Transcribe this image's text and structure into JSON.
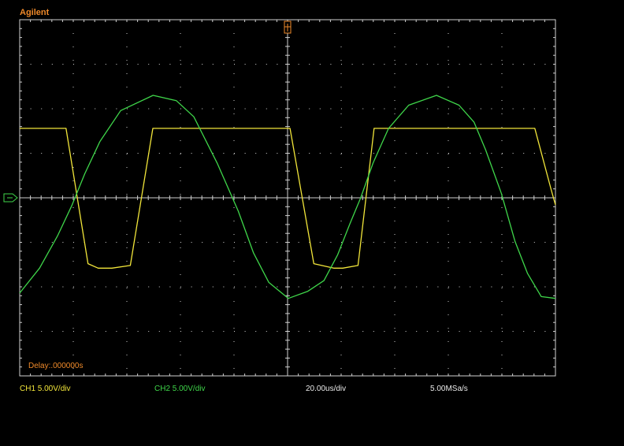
{
  "brand": "Agilent",
  "delay_text": "Delay:.000000s",
  "footer": {
    "ch1": "CH1 5.00V/div",
    "ch2": "CH2 5.00V/div",
    "timebase": "20.00us/div",
    "sample_rate": "5.00MSa/s"
  },
  "colors": {
    "ch1": "#f2e63a",
    "ch2": "#3fd64a",
    "accent": "#f08a2a",
    "grid": "#d0d0d0"
  },
  "chart_data": {
    "type": "line",
    "grid": true,
    "xlim": [
      -100,
      100
    ],
    "ylim": [
      -20,
      20
    ],
    "x_unit": "us",
    "y_unit": "V",
    "x_divisions": 10,
    "y_divisions": 8,
    "series": [
      {
        "name": "CH1",
        "color": "#f2e63a",
        "x": [
          -100,
          -82.7,
          -74.5,
          -70.7,
          -65.6,
          -58.7,
          -50.3,
          0.9,
          9.8,
          17.2,
          20.6,
          26.3,
          32.3,
          40.8,
          92.3,
          98.5,
          100
        ],
        "y": [
          7.8,
          7.8,
          -7.4,
          -7.9,
          -7.9,
          -7.6,
          7.8,
          7.8,
          -7.4,
          -7.9,
          -7.9,
          -7.6,
          7.8,
          7.8,
          7.8,
          0.8,
          -0.8
        ]
      },
      {
        "name": "CH2",
        "color": "#3fd64a",
        "x": [
          -100,
          -92.6,
          -85.9,
          -80.6,
          -75.7,
          -70.1,
          -62.3,
          -50.2,
          -41.5,
          -35,
          -26.3,
          -18.4,
          -12.7,
          -7,
          0.3,
          7.6,
          13.6,
          18.7,
          23.3,
          27.3,
          31.9,
          37.7,
          45.2,
          55.6,
          64,
          69.6,
          73.9,
          79.8,
          84.9,
          89.6,
          94.7,
          100
        ],
        "y": [
          -10.7,
          -7.9,
          -4.3,
          -0.9,
          2.7,
          6.3,
          9.8,
          11.5,
          10.9,
          9.1,
          3.9,
          -1.5,
          -6.2,
          -9.5,
          -11.3,
          -10.5,
          -9.3,
          -6.4,
          -2.9,
          0,
          3.9,
          7.8,
          10.4,
          11.5,
          10.4,
          8.5,
          5.4,
          0.5,
          -4.9,
          -8.5,
          -11.1,
          -11.3
        ]
      }
    ]
  }
}
